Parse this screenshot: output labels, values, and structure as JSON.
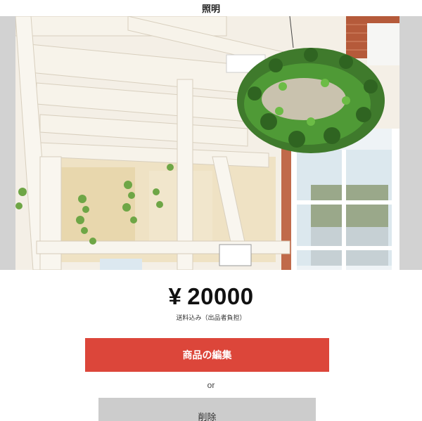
{
  "header": {
    "title": "照明"
  },
  "item": {
    "photo_alt": "hanging-plant-interior-photo",
    "currency_symbol": "¥",
    "price": "20000",
    "shipping_note": "送料込み（出品者負担）"
  },
  "actions": {
    "edit_label": "商品の編集",
    "separator": "or",
    "delete_label": "削除"
  },
  "colors": {
    "edit_button": "#dc463a",
    "delete_button": "#cccccc",
    "photo_background": "#d2d2d2"
  }
}
